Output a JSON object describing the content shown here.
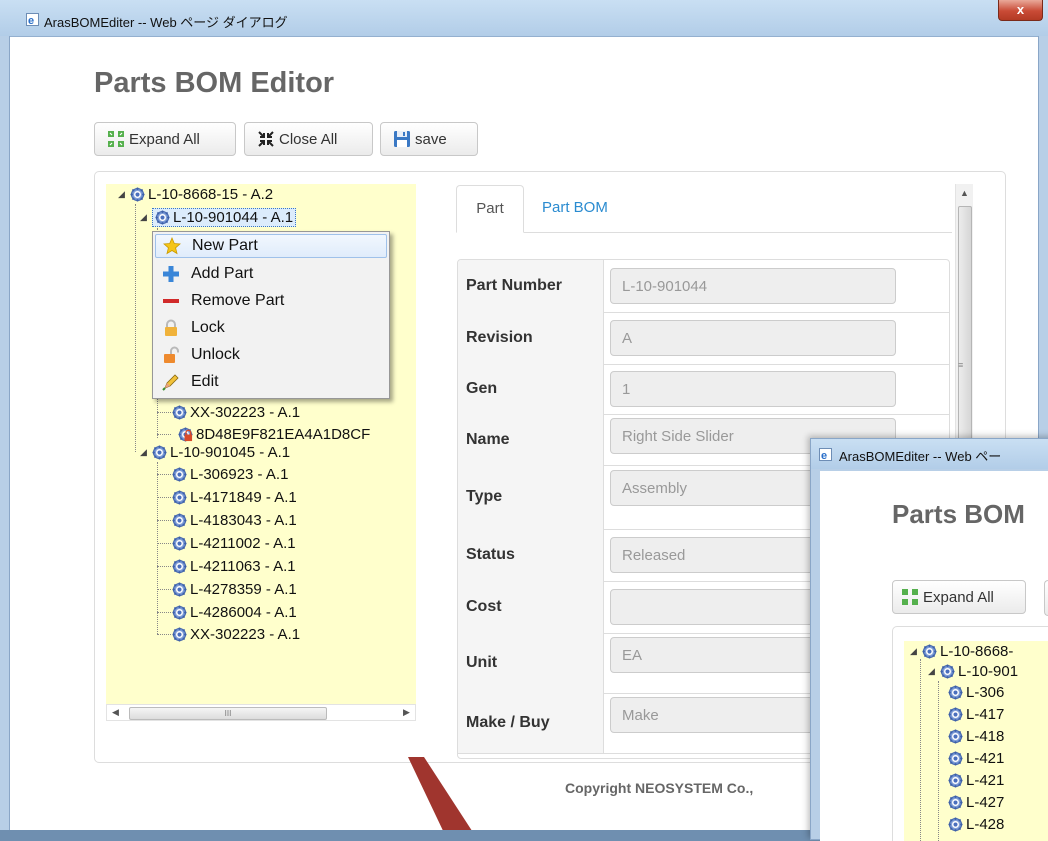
{
  "window": {
    "title": "ArasBOMEditer -- Web ページ ダイアログ",
    "close_label": "x"
  },
  "page": {
    "title": "Parts BOM Editor",
    "copyright": "Copyright NEOSYSTEM Co.,"
  },
  "toolbar": {
    "expand_all": "Expand All",
    "close_all": "Close All",
    "save": "save"
  },
  "tree": {
    "nodes": [
      "L-10-8668-15 - A.2",
      "L-10-901044 - A.1",
      "XX-302223 - A.1",
      "8D48E9F821EA4A1D8CF",
      "L-10-901045 - A.1",
      "L-306923 - A.1",
      "L-4171849 - A.1",
      "L-4183043 - A.1",
      "L-4211002 - A.1",
      "L-4211063 - A.1",
      "L-4278359 - A.1",
      "L-4286004 - A.1",
      "XX-302223 - A.1"
    ],
    "scroll_thumb_label": "III"
  },
  "context_menu": {
    "items": [
      "New Part",
      "Add Part",
      "Remove Part",
      "Lock",
      "Unlock",
      "Edit"
    ],
    "hovered": "New Part"
  },
  "tabs": {
    "items": [
      "Part",
      "Part BOM"
    ],
    "active": "Part"
  },
  "form": {
    "rows": [
      {
        "label": "Part Number",
        "value": "L-10-901044"
      },
      {
        "label": "Revision",
        "value": "A"
      },
      {
        "label": "Gen",
        "value": "1"
      },
      {
        "label": "Name",
        "value": "Right Side Slider"
      },
      {
        "label": "Type",
        "value": "Assembly"
      },
      {
        "label": "Status",
        "value": "Released"
      },
      {
        "label": "Cost",
        "value": ""
      },
      {
        "label": "Unit",
        "value": "EA"
      },
      {
        "label": "Make / Buy",
        "value": "Make"
      }
    ]
  },
  "second_window": {
    "title": "ArasBOMEditer -- Web ペー",
    "page_title": "Parts BOM",
    "expand_all": "Expand All",
    "tree_nodes": [
      "L-10-8668-",
      "L-10-901",
      "L-306",
      "L-417",
      "L-418",
      "L-421",
      "L-421",
      "L-427",
      "L-428"
    ]
  },
  "colors": {
    "tree_background": "#ffffcc",
    "link_blue": "#2a8bd0",
    "title_gray": "#666666",
    "close_button_red": "#c94b36",
    "arrow_red": "#a0352e"
  },
  "icons": {
    "window": "ie-page-icon",
    "expand": "expand-arrows-icon",
    "collapse": "collapse-arrows-icon",
    "save": "floppy-disk-icon",
    "part": "gear-icon",
    "new_part": "star-icon",
    "add_part": "plus-icon",
    "remove_part": "minus-icon",
    "lock": "lock-icon",
    "unlock": "unlock-icon",
    "edit": "pencil-icon"
  }
}
